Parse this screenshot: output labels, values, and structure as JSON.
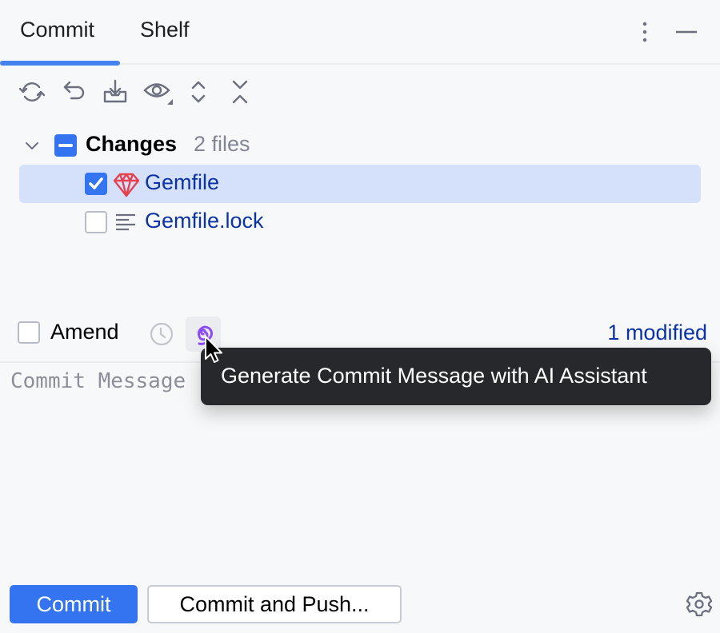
{
  "tabs": [
    {
      "label": "Commit",
      "active": true
    },
    {
      "label": "Shelf",
      "active": false
    }
  ],
  "header_actions": [
    {
      "icon": "more-vertical-icon"
    },
    {
      "icon": "minimize-icon"
    }
  ],
  "toolbar": [
    {
      "icon": "refresh-icon"
    },
    {
      "icon": "rollback-icon"
    },
    {
      "icon": "update-download-icon"
    },
    {
      "icon": "preview-eye-icon"
    },
    {
      "icon": "expand-all-icon"
    },
    {
      "icon": "collapse-all-icon"
    }
  ],
  "changes": {
    "label": "Changes",
    "count": "2 files",
    "checkbox_state": "partial",
    "expanded": true,
    "files": [
      {
        "name": "Gemfile",
        "checked": true,
        "selected": true,
        "icon": "ruby-gem-icon"
      },
      {
        "name": "Gemfile.lock",
        "checked": false,
        "selected": false,
        "icon": "text-file-icon"
      }
    ]
  },
  "amend": {
    "label": "Amend",
    "checked": false
  },
  "modified_link": "1 modified",
  "commit_message": {
    "value": "",
    "placeholder": "Commit Message"
  },
  "tooltip": "Generate Commit Message with AI Assistant",
  "buttons": {
    "commit": "Commit",
    "commit_and_push": "Commit and Push..."
  },
  "colors": {
    "accent": "#3574f0",
    "tab_underline": "#4682ee",
    "link": "#0c33a5",
    "selection": "#d5e1fb",
    "ai_purple": "#8b4cf6",
    "gem_red": "#e5414e",
    "tooltip_bg": "#27282c"
  }
}
